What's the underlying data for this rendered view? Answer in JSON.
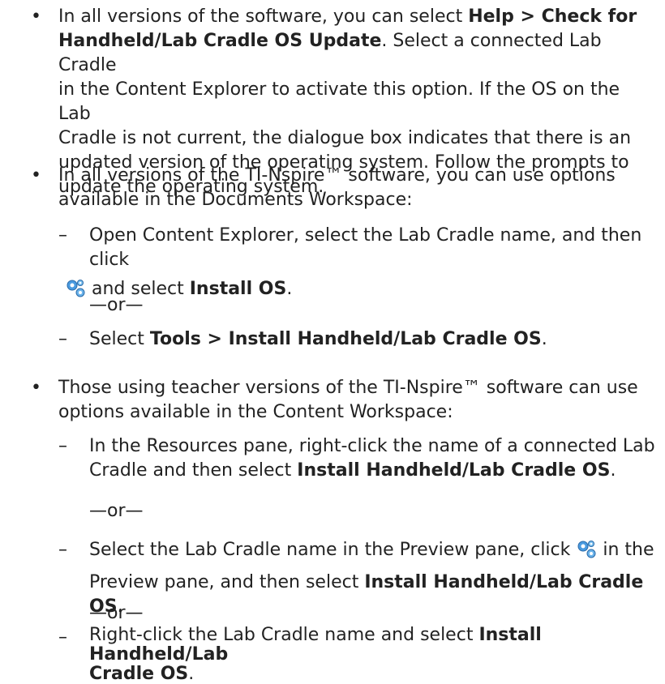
{
  "bullets": [
    {
      "line1": "In all versions of the software, you can select ",
      "bold1": "Help > Check for",
      "line2_bold": "Handheld/Lab Cradle OS Update",
      "line2": ". Select a connected Lab Cradle",
      "line3": "in the Content Explorer to activate this option. If the OS on the Lab",
      "line4": "Cradle is not current, the dialogue box indicates that there is an",
      "line5": "updated version of the operating system. Follow the prompts to",
      "line6": "update the operating system."
    },
    {
      "line1": "In all versions of the TI-Nspire™ software, you can use options",
      "line2": "available in the Documents Workspace:",
      "sub1_line1": "Open Content Explorer, select the Lab Cradle name, and then click",
      "sub1_line2a": " and select ",
      "sub1_line2b": "Install OS",
      "sub1_line2c": ".",
      "or": "—or—",
      "sub2_a": "Select ",
      "sub2_b": "Tools > Install Handheld/Lab Cradle OS",
      "sub2_c": "."
    },
    {
      "line1": "Those using teacher versions of the TI-Nspire™ software can use",
      "line2": "options available in the Content Workspace:",
      "sub1_line1": "In the Resources pane, right-click the name of a connected Lab",
      "sub1_line2a": "Cradle and then select ",
      "sub1_line2b": "Install Handheld/Lab Cradle OS",
      "sub1_line2c": ".",
      "or1": "—or—",
      "sub2_line1a": "Select the Lab Cradle name in the Preview pane, click ",
      "sub2_line1b": " in the",
      "sub2_line2a": "Preview pane, and then select ",
      "sub2_line2b": "Install Handheld/Lab Cradle OS",
      "sub2_line2c": ".",
      "or2": "—or—",
      "sub3_line1a": "Right-click the Lab Cradle name and select ",
      "sub3_line1b": "Install Handheld/Lab",
      "sub3_line2b": "Cradle OS",
      "sub3_line2c": "."
    }
  ],
  "symbols": {
    "bullet": "•",
    "dash": "–"
  },
  "icons": {
    "gear": "settings-gear-icon",
    "gear_color": "#3a8fd1"
  }
}
